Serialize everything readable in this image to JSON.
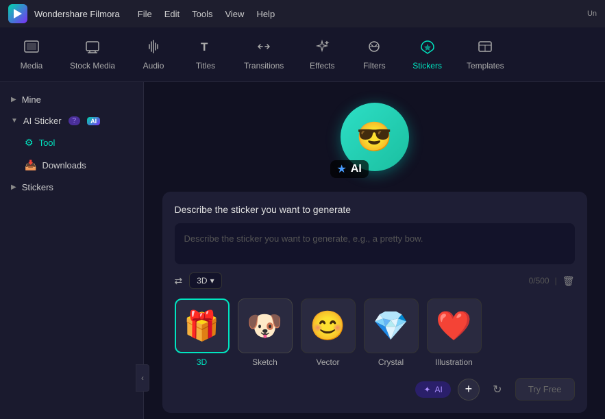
{
  "titleBar": {
    "appName": "Wondershare Filmora",
    "logoText": "▶",
    "menuItems": [
      "File",
      "Edit",
      "Tools",
      "View",
      "Help"
    ],
    "windowControls": "Un"
  },
  "topNav": {
    "items": [
      {
        "id": "media",
        "label": "Media",
        "icon": "⬛",
        "iconType": "media",
        "active": false
      },
      {
        "id": "stock-media",
        "label": "Stock Media",
        "icon": "📥",
        "iconType": "stock",
        "active": false
      },
      {
        "id": "audio",
        "label": "Audio",
        "icon": "♪",
        "iconType": "audio",
        "active": false
      },
      {
        "id": "titles",
        "label": "Titles",
        "icon": "T",
        "iconType": "titles",
        "active": false
      },
      {
        "id": "transitions",
        "label": "Transitions",
        "icon": "⇄",
        "iconType": "transitions",
        "active": false
      },
      {
        "id": "effects",
        "label": "Effects",
        "icon": "✦",
        "iconType": "effects",
        "active": false
      },
      {
        "id": "filters",
        "label": "Filters",
        "icon": "⬡",
        "iconType": "filters",
        "active": false
      },
      {
        "id": "stickers",
        "label": "Stickers",
        "icon": "✿",
        "iconType": "stickers",
        "active": true
      },
      {
        "id": "templates",
        "label": "Templates",
        "icon": "▦",
        "iconType": "templates",
        "active": false
      }
    ]
  },
  "sidebar": {
    "sections": [
      {
        "id": "mine",
        "label": "Mine",
        "expanded": false,
        "hasArrow": true
      },
      {
        "id": "ai-sticker",
        "label": "AI Sticker",
        "expanded": true,
        "hasArrow": true,
        "hasBadge": true,
        "aiLabel": "AI",
        "subItems": [
          {
            "id": "tool",
            "label": "Tool",
            "icon": "🔧",
            "active": true
          },
          {
            "id": "downloads",
            "label": "Downloads",
            "icon": "📥",
            "active": false
          }
        ]
      },
      {
        "id": "stickers",
        "label": "Stickers",
        "expanded": false,
        "hasArrow": true
      }
    ]
  },
  "content": {
    "preview": {
      "altText": "AI Sticker preview creature",
      "aiLabel": "AI"
    },
    "generateBox": {
      "title": "Describe the sticker you want to generate",
      "placeholder": "Describe the sticker you want to generate, e.g., a pretty bow.",
      "charCount": "0/500",
      "selectedStyle": "3D",
      "styleOptions": [
        "3D"
      ],
      "styles": [
        {
          "id": "3d",
          "label": "3D",
          "emoji": "🎁",
          "selected": true
        },
        {
          "id": "sketch",
          "label": "Sketch",
          "emoji": "🐶",
          "selected": false
        },
        {
          "id": "vector",
          "label": "Vector",
          "emoji": "😊",
          "selected": false
        },
        {
          "id": "crystal",
          "label": "Crystal",
          "emoji": "💎",
          "selected": false
        },
        {
          "id": "illustration",
          "label": "Illustration",
          "emoji": "❤️",
          "selected": false
        }
      ],
      "tryFreeLabel": "Try Free",
      "aiCostLabel": "AI"
    }
  }
}
